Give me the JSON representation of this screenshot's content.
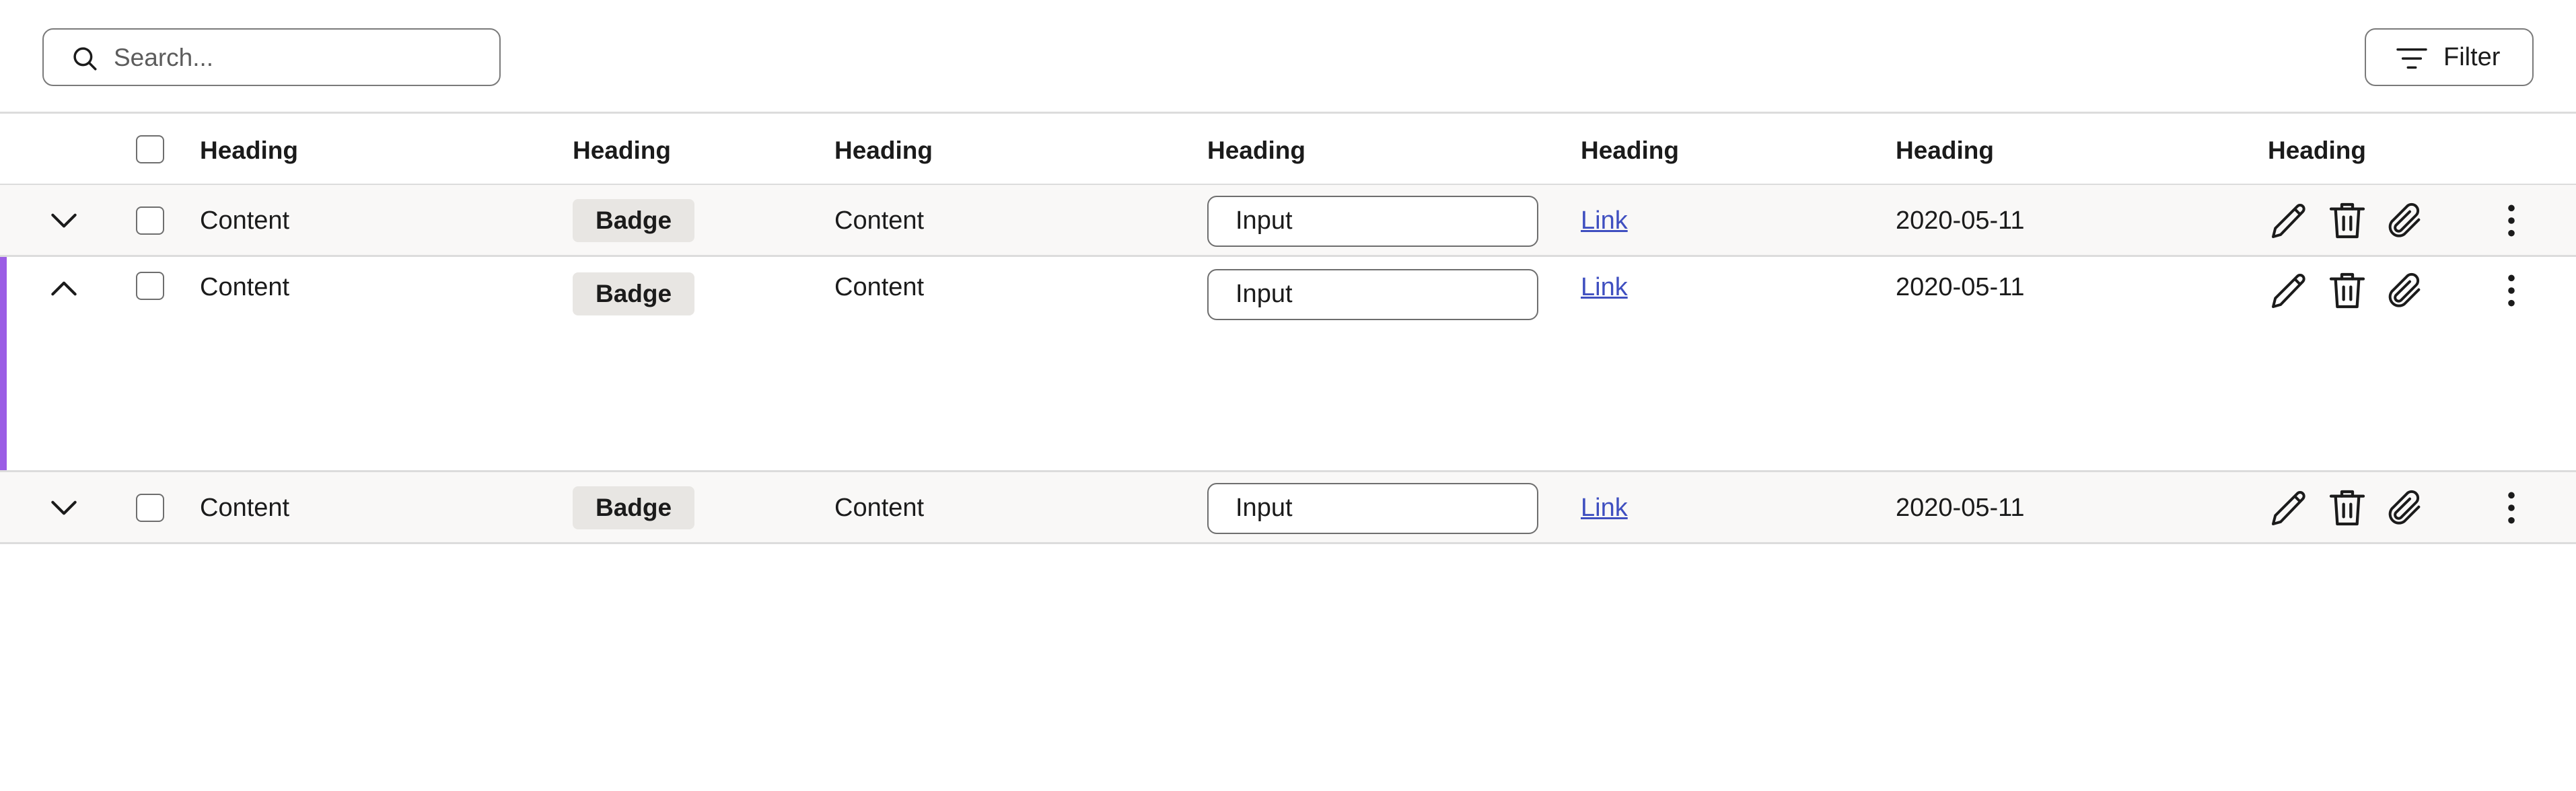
{
  "toolbar": {
    "search_placeholder": "Search...",
    "filter_label": "Filter"
  },
  "table": {
    "headings": [
      "Heading",
      "Heading",
      "Heading",
      "Heading",
      "Heading",
      "Heading",
      "Heading"
    ],
    "rows": [
      {
        "expanded": false,
        "content1": "Content",
        "badge": "Badge",
        "content2": "Content",
        "input": "Input",
        "link": "Link",
        "date": "2020-05-11"
      },
      {
        "expanded": true,
        "content1": "Content",
        "badge": "Badge",
        "content2": "Content",
        "input": "Input",
        "link": "Link",
        "date": "2020-05-11"
      },
      {
        "expanded": false,
        "content1": "Content",
        "badge": "Badge",
        "content2": "Content",
        "input": "Input",
        "link": "Link",
        "date": "2020-05-11"
      }
    ]
  },
  "colors": {
    "accent": "#9b5de5",
    "link": "#3f4fc0",
    "badge_bg": "#e8e6e3",
    "row_bg": "#f9f8f7"
  },
  "icons": [
    "search-icon",
    "filter-icon",
    "chevron-down-icon",
    "chevron-up-icon",
    "pencil-icon",
    "trash-icon",
    "paperclip-icon",
    "more-vertical-icon"
  ]
}
